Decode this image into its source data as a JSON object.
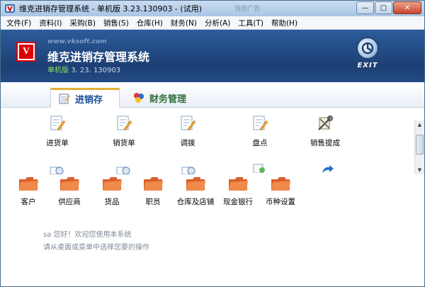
{
  "window": {
    "title": "维克进销存管理系统 - 单机版 3.23.130903 - (试用)",
    "ghost_text": "当你广告",
    "minimize": "—",
    "maximize": "□",
    "close": "✕"
  },
  "menu": [
    "文件(F)",
    "资料(I)",
    "采购(B)",
    "销售(S)",
    "仓库(H)",
    "财务(N)",
    "分析(A)",
    "工具(T)",
    "帮助(H)"
  ],
  "banner": {
    "logo_letter": "V",
    "site": "www.vksoft.com",
    "app_name": "维克进销存管理系统",
    "version_label": "单机版",
    "version_number": "3. 23. 130903",
    "exit_label": "EXIT"
  },
  "tabs": {
    "active": "进销存",
    "other": "财务管理"
  },
  "actions": [
    "进货单",
    "销货单",
    "调拨",
    "盘点",
    "销售提成"
  ],
  "folders": [
    "客户",
    "供应商",
    "货品",
    "职员",
    "仓库及店铺",
    "现金银行",
    "币种设置"
  ],
  "status": {
    "user_prefix": "sa",
    "welcome": "您好！欢迎您使用本系统",
    "hint": "请从桌面或菜单中选择您要的操作"
  },
  "colors": {
    "banner": "#1c3f74",
    "folder": "#e8753a",
    "accent_tab": "#e5b03a",
    "logo_red": "#dd0000"
  },
  "icons": {
    "action": "document-pen-icon",
    "sales_commission": "tools-scroll-icon",
    "folder": "orange-folder-icon",
    "exit": "exit-gear-icon"
  }
}
